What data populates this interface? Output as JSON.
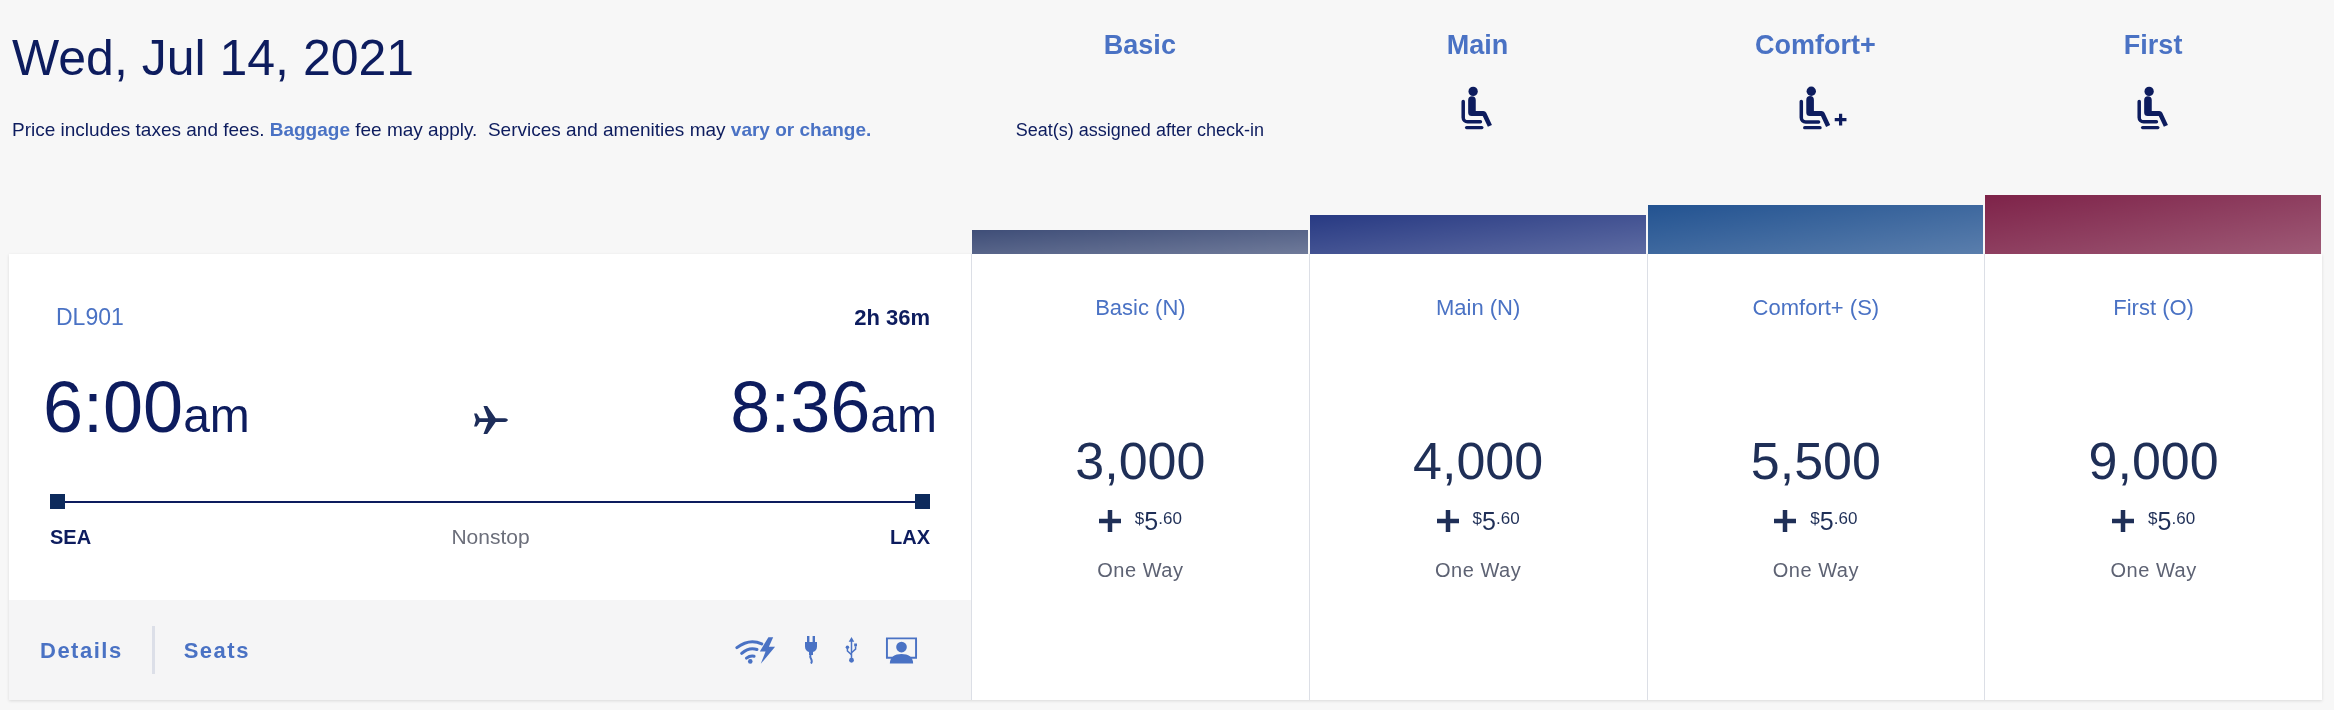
{
  "header": {
    "date": "Wed, Jul 14, 2021",
    "notice": [
      {
        "kind": "text",
        "text": "Price includes taxes and fees. "
      },
      {
        "kind": "link",
        "text": "Baggage"
      },
      {
        "kind": "text",
        "text": " fee may apply.  Services and amenities may "
      },
      {
        "kind": "link",
        "text": "vary or change."
      }
    ]
  },
  "cabins": [
    {
      "name": "Basic",
      "kind": "note",
      "note": "Seat(s) assigned after check-in",
      "color": "#3f4e78"
    },
    {
      "name": "Main",
      "kind": "seat",
      "color": "#283a83"
    },
    {
      "name": "Comfort+",
      "kind": "seat_plus",
      "color": "#235391"
    },
    {
      "name": "First",
      "kind": "seat",
      "color": "#7e2349"
    }
  ],
  "flight": {
    "number": "DL901",
    "duration": "2h 36m",
    "depart": {
      "time": "6:00",
      "period": "am",
      "airport": "SEA"
    },
    "arrive": {
      "time": "8:36",
      "period": "am",
      "airport": "LAX"
    },
    "stops": "Nonstop",
    "links": [
      "Details",
      "Seats"
    ]
  },
  "fares": [
    {
      "cabin": "Basic (N)",
      "miles": "3,000",
      "fee": {
        "symbol": "$",
        "whole": "5",
        "fraction": ".60"
      },
      "trip": "One Way"
    },
    {
      "cabin": "Main (N)",
      "miles": "4,000",
      "fee": {
        "symbol": "$",
        "whole": "5",
        "fraction": ".60"
      },
      "trip": "One Way"
    },
    {
      "cabin": "Comfort+ (S)",
      "miles": "5,500",
      "fee": {
        "symbol": "$",
        "whole": "5",
        "fraction": ".60"
      },
      "trip": "One Way"
    },
    {
      "cabin": "First (O)",
      "miles": "9,000",
      "fee": {
        "symbol": "$",
        "whole": "5",
        "fraction": ".60"
      },
      "trip": "One Way"
    }
  ]
}
